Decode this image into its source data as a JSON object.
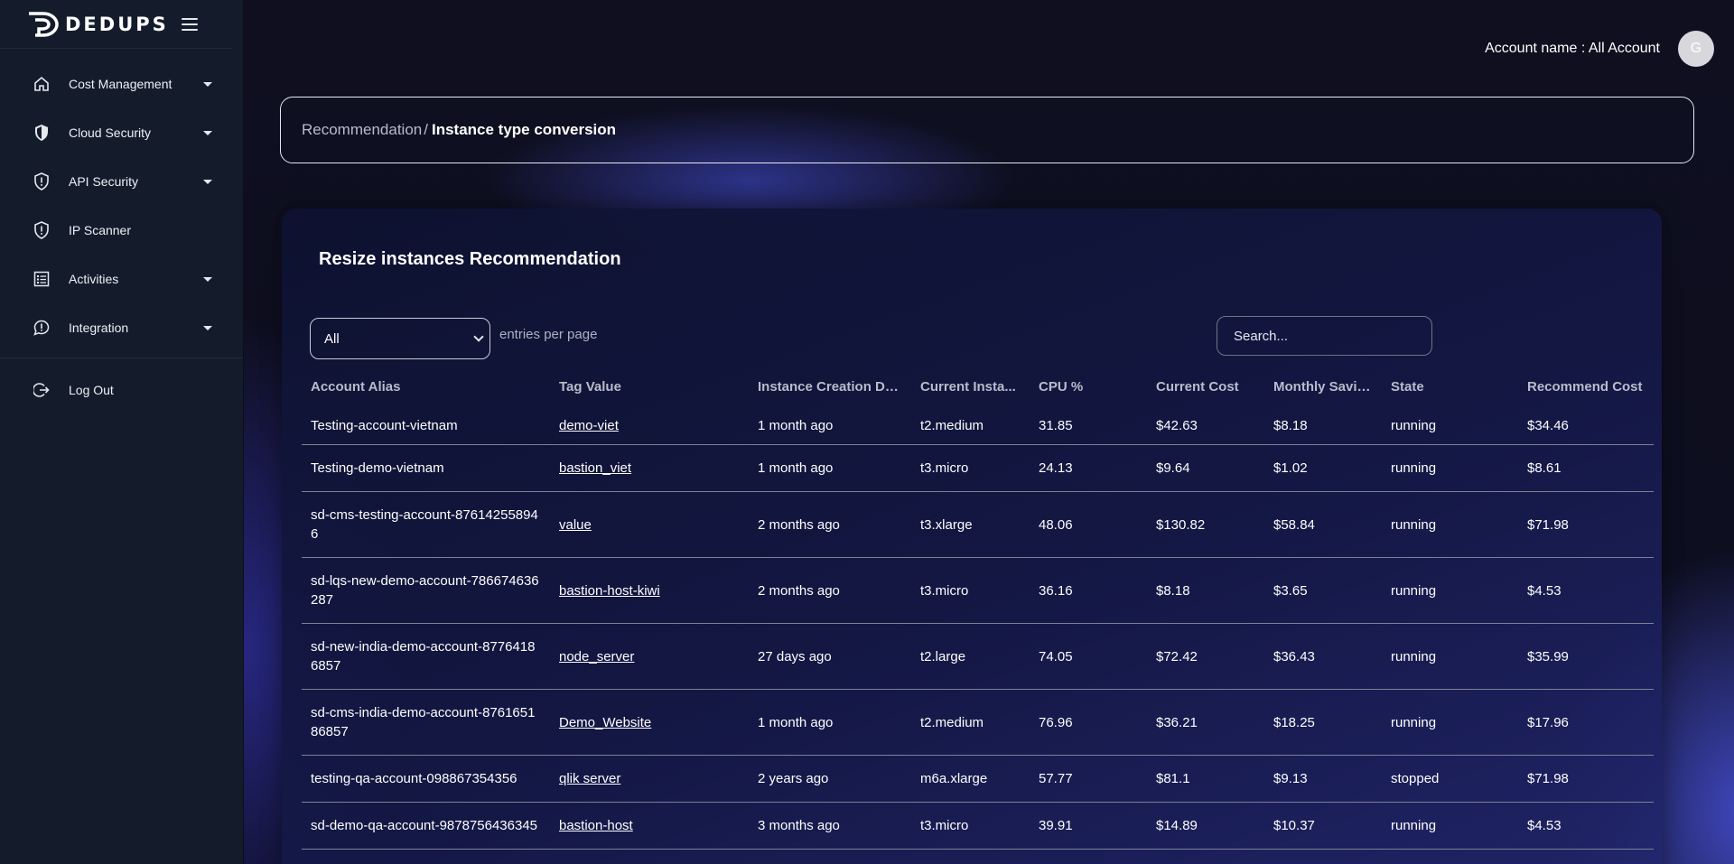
{
  "brand": {
    "name": "DEDUPS"
  },
  "sidebar": {
    "items": [
      {
        "label": "Cost Management",
        "icon": "home-icon",
        "has_caret": true
      },
      {
        "label": "Cloud Security",
        "icon": "shield-icon",
        "has_caret": true
      },
      {
        "label": "API Security",
        "icon": "shield-alert-icon",
        "has_caret": true
      },
      {
        "label": "IP Scanner",
        "icon": "shield-alert-icon",
        "has_caret": false
      },
      {
        "label": "Activities",
        "icon": "list-icon",
        "has_caret": true
      },
      {
        "label": "Integration",
        "icon": "chat-alert-icon",
        "has_caret": true
      }
    ],
    "logout_label": "Log Out"
  },
  "header": {
    "account_label": "Account name : All Account",
    "avatar_initial": "G"
  },
  "breadcrumb": {
    "parent": "Recommendation",
    "separator": "/",
    "current": "Instance type conversion"
  },
  "card": {
    "title": "Resize instances Recommendation",
    "entries_select_value": "All",
    "entries_text": "entries per page",
    "search_placeholder": "Search..."
  },
  "table": {
    "columns": [
      "Account Alias",
      "Tag Value",
      "Instance Creation Date",
      "Current Insta...",
      "CPU %",
      "Current Cost",
      "Monthly Saving",
      "State",
      "Recommend Cost"
    ],
    "rows": [
      [
        "Testing-account-vietnam",
        "demo-viet",
        "1 month ago",
        "t2.medium",
        "31.85",
        "$42.63",
        "$8.18",
        "running",
        "$34.46"
      ],
      [
        "Testing-demo-vietnam",
        "bastion_viet",
        "1 month ago",
        "t3.micro",
        "24.13",
        "$9.64",
        "$1.02",
        "running",
        "$8.61"
      ],
      [
        "sd-cms-testing-account-876142558946",
        "value",
        "2 months ago",
        "t3.xlarge",
        "48.06",
        "$130.82",
        "$58.84",
        "running",
        "$71.98"
      ],
      [
        "sd-lqs-new-demo-account-786674636287",
        "bastion-host-kiwi",
        "2 months ago",
        "t3.micro",
        "36.16",
        "$8.18",
        "$3.65",
        "running",
        "$4.53"
      ],
      [
        "sd-new-india-demo-account-87764186857",
        "node_server",
        "27 days ago",
        "t2.large",
        "74.05",
        "$72.42",
        "$36.43",
        "running",
        "$35.99"
      ],
      [
        "sd-cms-india-demo-account-876165186857",
        "Demo_Website",
        "1 month ago",
        "t2.medium",
        "76.96",
        "$36.21",
        "$18.25",
        "running",
        "$17.96"
      ],
      [
        "testing-qa-account-098867354356",
        "qlik server",
        "2 years ago",
        "m6a.xlarge",
        "57.77",
        "$81.1",
        "$9.13",
        "stopped",
        "$71.98"
      ],
      [
        "sd-demo-qa-account-9878756436345",
        "bastion-host",
        "3 months ago",
        "t3.micro",
        "39.91",
        "$14.89",
        "$10.37",
        "running",
        "$4.53"
      ]
    ]
  }
}
